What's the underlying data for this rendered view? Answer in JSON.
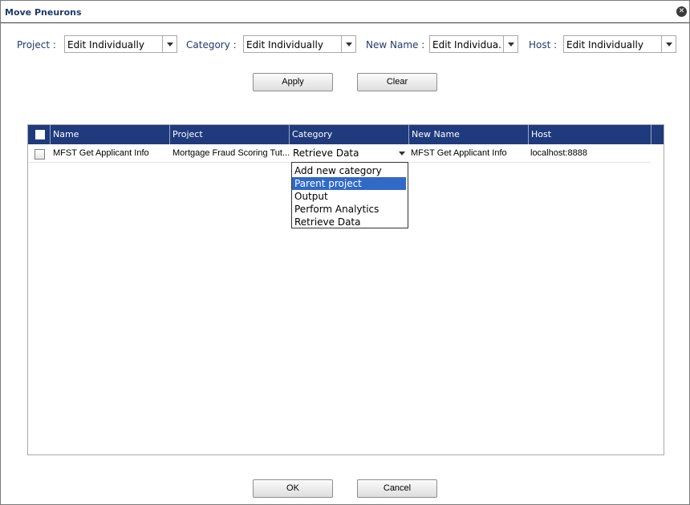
{
  "dialog": {
    "title": "Move Pneurons",
    "close_icon": "close-icon"
  },
  "filters": {
    "project": {
      "label": "Project :",
      "value": "Edit Individually"
    },
    "category": {
      "label": "Category :",
      "value": "Edit Individually"
    },
    "new_name": {
      "label": "New Name :",
      "value": "Edit Individua..."
    },
    "host": {
      "label": "Host :",
      "value": "Edit Individually"
    }
  },
  "buttons": {
    "apply": "Apply",
    "clear": "Clear",
    "ok": "OK",
    "cancel": "Cancel"
  },
  "grid": {
    "columns": [
      "Name",
      "Project",
      "Category",
      "New Name",
      "Host"
    ],
    "rows": [
      {
        "name": "MFST Get Applicant Info",
        "project": "Mortgage Fraud Scoring Tut...",
        "category": "Retrieve Data",
        "new_name": "MFST Get Applicant Info",
        "host": "localhost:8888"
      }
    ]
  },
  "category_dropdown": {
    "options": [
      "Add new category",
      "Parent project",
      "Output",
      "Perform Analytics",
      "Retrieve Data"
    ],
    "highlighted": "Parent project"
  },
  "colors": {
    "header_bg": "#1f3a7d",
    "label_color": "#1f3a6e",
    "highlight": "#3169c6"
  }
}
